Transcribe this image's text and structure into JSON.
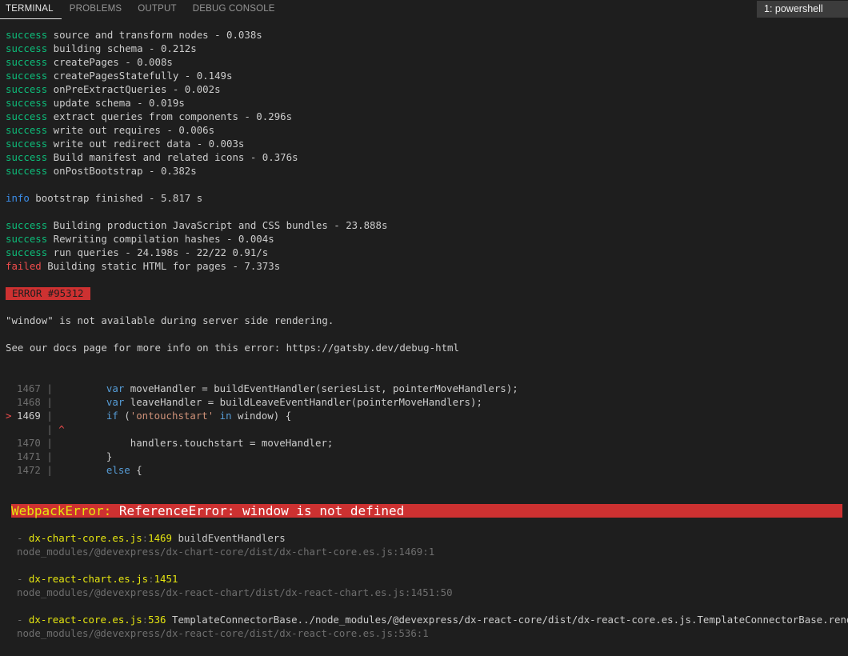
{
  "tabs": [
    {
      "label": "TERMINAL",
      "active": true
    },
    {
      "label": "PROBLEMS",
      "active": false
    },
    {
      "label": "OUTPUT",
      "active": false
    },
    {
      "label": "DEBUG CONSOLE",
      "active": false
    }
  ],
  "terminal_select": "1: powershell",
  "success_lines": [
    {
      "status": "success",
      "text": " source and transform nodes - 0.038s"
    },
    {
      "status": "success",
      "text": " building schema - 0.212s"
    },
    {
      "status": "success",
      "text": " createPages - 0.008s"
    },
    {
      "status": "success",
      "text": " createPagesStatefully - 0.149s"
    },
    {
      "status": "success",
      "text": " onPreExtractQueries - 0.002s"
    },
    {
      "status": "success",
      "text": " update schema - 0.019s"
    },
    {
      "status": "success",
      "text": " extract queries from components - 0.296s"
    },
    {
      "status": "success",
      "text": " write out requires - 0.006s"
    },
    {
      "status": "success",
      "text": " write out redirect data - 0.003s"
    },
    {
      "status": "success",
      "text": " Build manifest and related icons - 0.376s"
    },
    {
      "status": "success",
      "text": " onPostBootstrap - 0.382s"
    }
  ],
  "info_line": {
    "status": "info",
    "text": " bootstrap finished - 5.817 s"
  },
  "build_lines": [
    {
      "status": "success",
      "text": " Building production JavaScript and CSS bundles - 23.888s"
    },
    {
      "status": "success",
      "text": " Rewriting compilation hashes - 0.004s"
    },
    {
      "status": "success",
      "text": " run queries - 24.198s - 22/22 0.91/s"
    },
    {
      "status": "failed",
      "text": " Building static HTML for pages - 7.373s"
    }
  ],
  "error_badge": "ERROR #95312",
  "error_message": "\"window\" is not available during server side rendering.",
  "docs_line": "See our docs page for more info on this error: https://gatsby.dev/debug-html",
  "code": {
    "l1467": {
      "num": "1467",
      "pre": "         ",
      "kw": "var",
      "rest": " moveHandler = buildEventHandler(seriesList, pointerMoveHandlers);"
    },
    "l1468": {
      "num": "1468",
      "pre": "         ",
      "kw": "var",
      "rest": " leaveHandler = buildLeaveEventHandler(pointerMoveHandlers);"
    },
    "l1469": {
      "num": "1469",
      "pre": "         ",
      "kw": "if",
      "rest1": " (",
      "str": "'ontouchstart'",
      "sp": " ",
      "kw2": "in",
      "rest2": " window) {"
    },
    "caret": "^",
    "l1470": {
      "num": "1470",
      "text": "             handlers.touchstart = moveHandler;"
    },
    "l1471": {
      "num": "1471",
      "text": "         }"
    },
    "l1472": {
      "num": "1472",
      "pre": "         ",
      "kw": "else",
      "rest": " {"
    }
  },
  "bar_char": "|",
  "marker_char": ">",
  "webpack_error": {
    "prefix": "WebpackError:",
    "text": " ReferenceError: window is not defined"
  },
  "stack": [
    {
      "file": "dx-chart-core.es.js",
      "line": "1469",
      "fn": " buildEventHandlers",
      "path": "node_modules/@devexpress/dx-chart-core/dist/dx-chart-core.es.js:1469:1"
    },
    {
      "file": "dx-react-chart.es.js",
      "line": "1451",
      "fn": "",
      "path": "node_modules/@devexpress/dx-react-chart/dist/dx-react-chart.es.js:1451:50"
    },
    {
      "file": "dx-react-core.es.js",
      "line": "536",
      "fn": " TemplateConnectorBase../node_modules/@devexpress/dx-react-core/dist/dx-react-core.es.js.TemplateConnectorBase.render",
      "path": "node_modules/@devexpress/dx-react-core/dist/dx-react-core.es.js:536:1"
    }
  ],
  "dash": "- ",
  "colon": ":",
  "colors": {
    "background": "#1e1e1e",
    "success": "#0dbc79",
    "info": "#3b8eea",
    "failed": "#f14c4c",
    "error_bg": "#cd3131",
    "file": "#e5e510"
  }
}
